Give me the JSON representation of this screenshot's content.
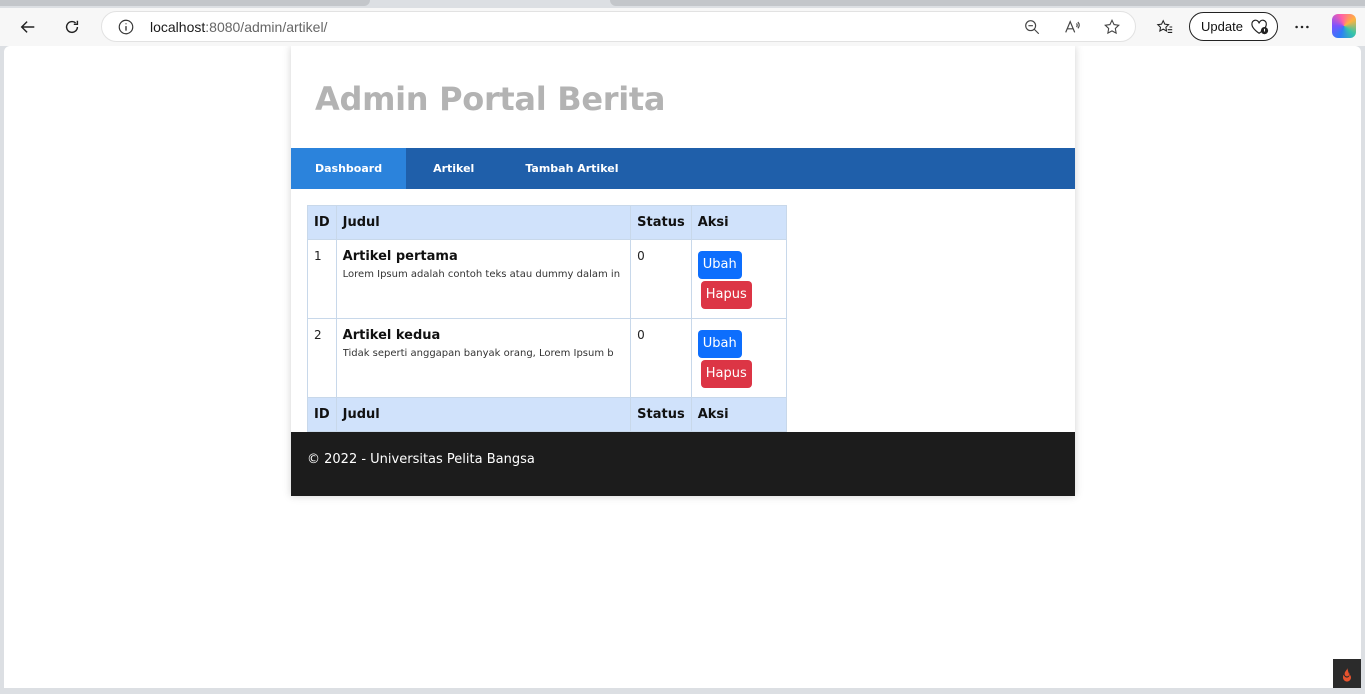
{
  "browser": {
    "url_host": "localhost",
    "url_rest": ":8080/admin/artikel/",
    "update_label": "Update",
    "icons": [
      "back-icon",
      "reload-icon",
      "info-icon",
      "zoom-out-icon",
      "read-aloud-icon",
      "favorite-star-icon",
      "favorites-icon",
      "more-icon",
      "copilot-icon"
    ]
  },
  "site": {
    "title": "Admin Portal Berita",
    "nav": [
      {
        "label": "Dashboard",
        "active": true
      },
      {
        "label": "Artikel",
        "active": false
      },
      {
        "label": "Tambah Artikel",
        "active": false
      }
    ]
  },
  "table": {
    "headers": [
      "ID",
      "Judul",
      "Status",
      "Aksi"
    ],
    "rows": [
      {
        "id": "1",
        "title": "Artikel pertama",
        "excerpt": "Lorem Ipsum adalah contoh teks atau dummy dalam in",
        "status": "0",
        "edit_label": "Ubah",
        "delete_label": "Hapus"
      },
      {
        "id": "2",
        "title": "Artikel kedua",
        "excerpt": "Tidak seperti anggapan banyak orang, Lorem Ipsum b",
        "status": "0",
        "edit_label": "Ubah",
        "delete_label": "Hapus"
      }
    ],
    "footer_headers": [
      "ID",
      "Judul",
      "Status",
      "Aksi"
    ]
  },
  "footer": {
    "text": "© 2022 - Universitas Pelita Bangsa"
  },
  "colors": {
    "nav_bg": "#1f5faa",
    "nav_active": "#2b83dc",
    "table_header": "#d0e2fb",
    "btn_edit": "#0d6efd",
    "btn_delete": "#dc3545",
    "footer_bg": "#1c1c1c"
  }
}
